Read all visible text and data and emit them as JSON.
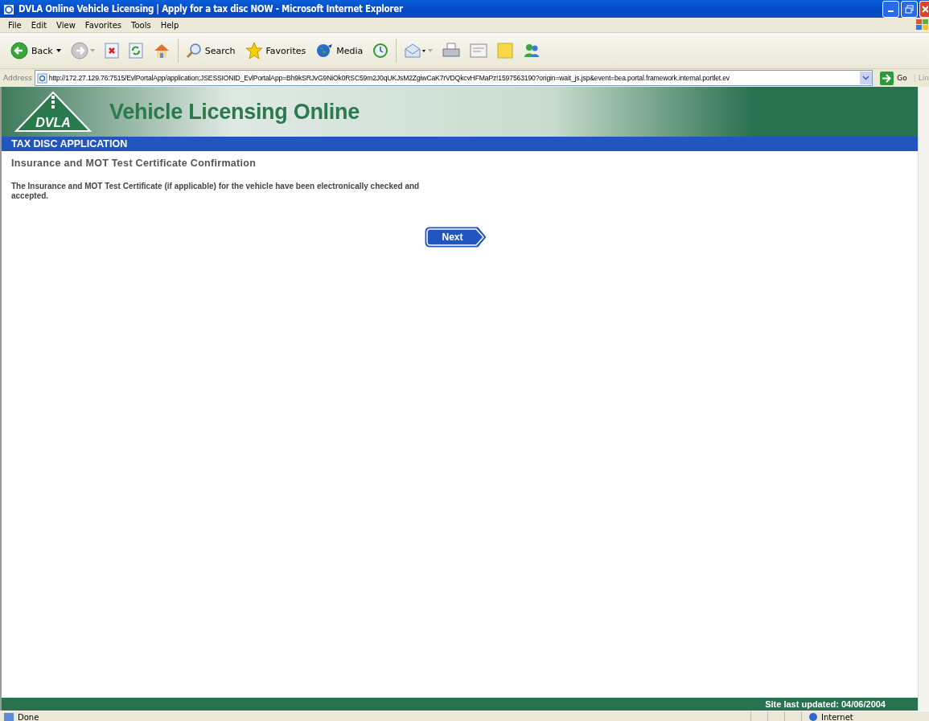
{
  "window": {
    "title": "DVLA Online Vehicle Licensing | Apply for a tax disc NOW - Microsoft Internet Explorer"
  },
  "menu": [
    "File",
    "Edit",
    "View",
    "Favorites",
    "Tools",
    "Help"
  ],
  "toolbar": [
    {
      "kind": "back",
      "label": "Back"
    },
    {
      "kind": "forward"
    },
    {
      "kind": "stop"
    },
    {
      "kind": "refresh"
    },
    {
      "kind": "home"
    },
    {
      "kind": "search",
      "label": "Search"
    },
    {
      "kind": "favorites",
      "label": "Favorites"
    },
    {
      "kind": "media",
      "label": "Media"
    },
    {
      "kind": "history"
    },
    {
      "kind": "mail"
    },
    {
      "kind": "print"
    },
    {
      "kind": "edit"
    },
    {
      "kind": "note"
    },
    {
      "kind": "messenger"
    }
  ],
  "address_bar": {
    "label": "Address",
    "url": "http://172.27.129.76:7515/EvlPortalApp/application;JSESSIONID_EvlPortalApp=Bh9kSRJvG9NiOk0RSC59m2J0qUKJsM2ZgiwCaK7rVDQkcvHFMaPz!1597563190?origin=wait_js.jsp&event=bea.portal.framework.internal.portlet.ev",
    "go": "Go",
    "links": "Lin"
  },
  "page": {
    "logo": "DVLA",
    "banner_title": "Vehicle Licensing Online",
    "section": "TAX DISC APPLICATION",
    "heading": "Insurance and MOT Test Certificate Confirmation",
    "message": "The Insurance and MOT Test Certificate (if applicable) for the vehicle have been electronically checked and accepted.",
    "next": "Next",
    "footer": "Site last updated: 04/06/2004"
  },
  "status_bar": {
    "text": "Done",
    "zone": "Internet"
  }
}
